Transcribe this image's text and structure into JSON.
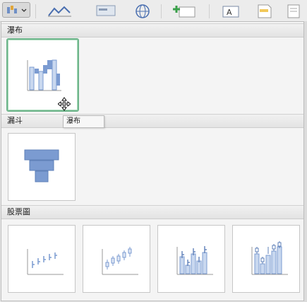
{
  "sections": [
    {
      "title": "瀑布"
    },
    {
      "title": "漏斗"
    },
    {
      "title": "股票圖"
    }
  ],
  "tooltip": {
    "text": "瀑布"
  },
  "colors": {
    "chart_fill": "#7b9bd1",
    "chart_fill_light": "#c9d8ef",
    "selection": "#6fb58c"
  },
  "icons": [
    "chart-type-icon",
    "dropdown-arrow-icon",
    "cursor-icon"
  ]
}
